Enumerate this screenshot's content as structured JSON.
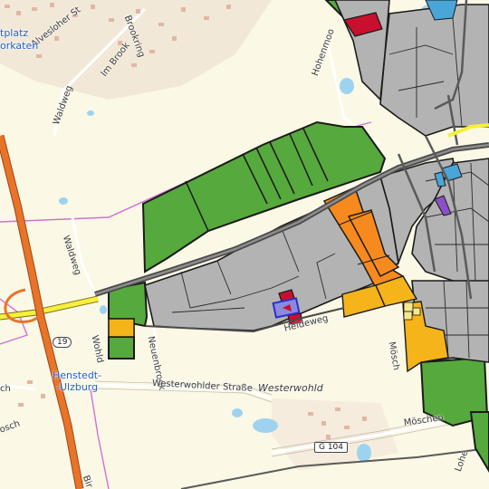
{
  "map": {
    "colors": {
      "background": "#fbf8e6",
      "green_zone": "#56a93c",
      "built_zone": "#b3b3b3",
      "orange_zone": "#f68a1e",
      "yellow_zone": "#f5b41a",
      "red_zone": "#c8102e",
      "motorway": "#e8742a",
      "trunk": "#f6ef3c",
      "boundary": "#d46fd6",
      "water": "#9ed3f0"
    },
    "labels": {
      "alvesloher": "Alvesloher St",
      "platz": "tplatz",
      "karten": "orkaten",
      "brookring": "Brookring",
      "im_brook": "Im Brook",
      "waldweg_1": "Waldweg",
      "waldweg_2": "Waldweg",
      "hohenmoor": "Hohenmoo",
      "heideweg": "Heideweg",
      "wohld": "Wohld",
      "neuenbrook": "Neuenbrook",
      "westerwohlder": "Westerwohlder Straße",
      "westerwohld": "Westerwohld",
      "henstedt": "Henstedt-",
      "ulzburg": "-Ulzburg",
      "moeschen": "Möschen",
      "moeschen_edge": "Mösch",
      "bir": "Bir",
      "lohe": "Lohe",
      "ch": "ch",
      "osch": "osch"
    },
    "shields": {
      "b19": "19",
      "g104": "G 104"
    }
  }
}
